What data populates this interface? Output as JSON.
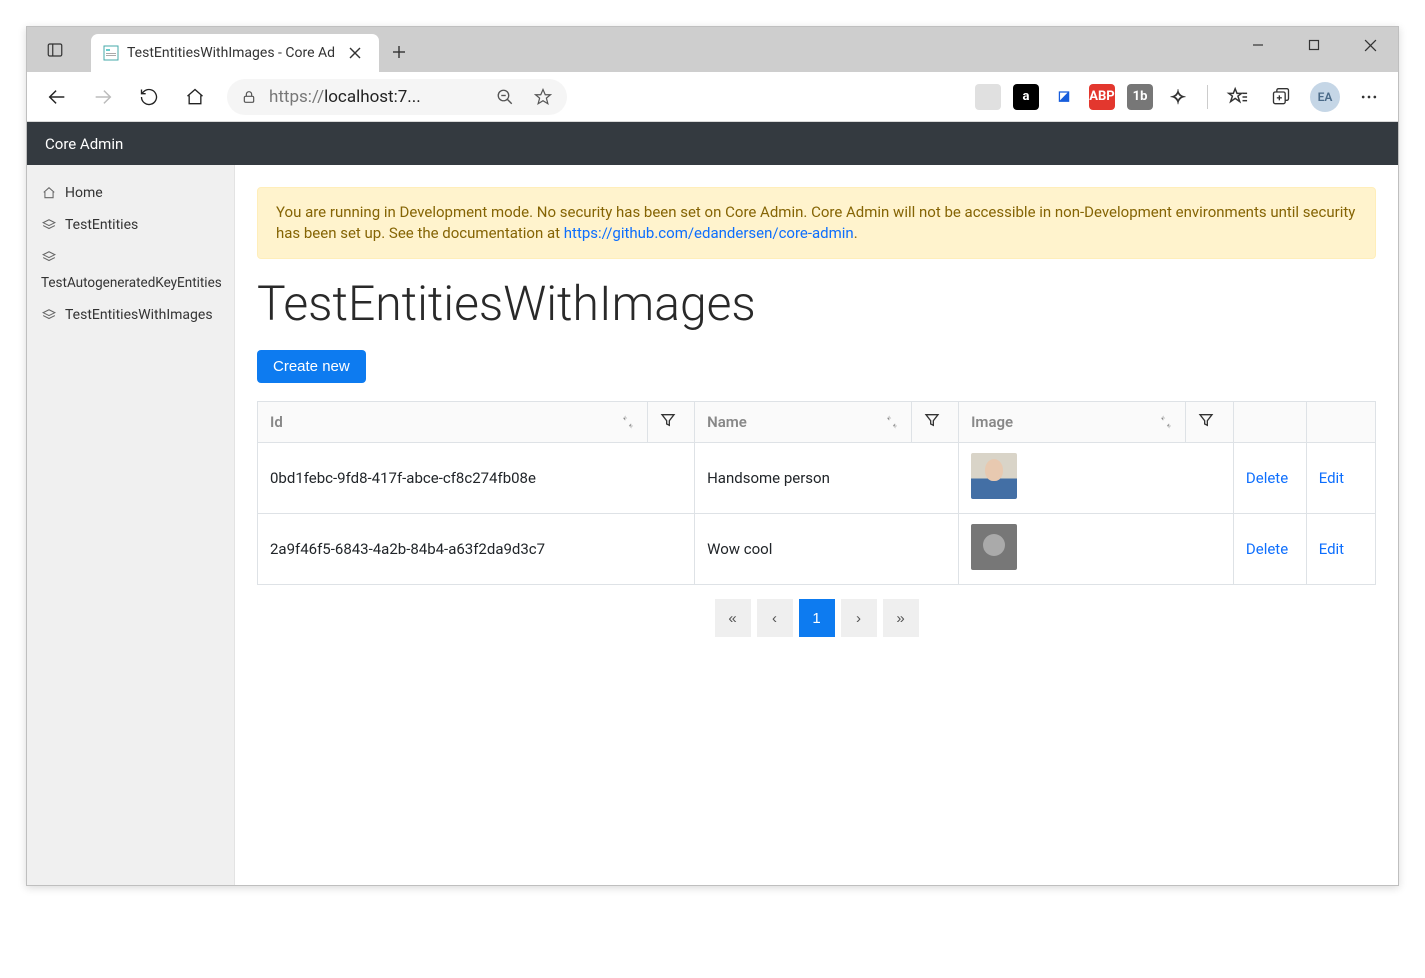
{
  "browser": {
    "tab_title": "TestEntitiesWithImages - Core Ad",
    "url_display": "localhost:7...",
    "url_prefix": "https://",
    "profile_initials": "EA",
    "extensions": [
      {
        "name": "ext-1",
        "bg": "#e0e0e0",
        "fg": "#888",
        "label": ""
      },
      {
        "name": "ext-privacy",
        "bg": "#000000",
        "fg": "#ffffff",
        "label": "a"
      },
      {
        "name": "ext-bitwarden",
        "bg": "#ffffff",
        "fg": "#175ddc",
        "label": "◪"
      },
      {
        "name": "ext-abp",
        "bg": "#e3372e",
        "fg": "#ffffff",
        "label": "ABP"
      },
      {
        "name": "ext-1b",
        "bg": "#777777",
        "fg": "#ffffff",
        "label": "1b"
      },
      {
        "name": "ext-puzzle",
        "bg": "transparent",
        "fg": "#333333",
        "label": "✧"
      }
    ]
  },
  "app": {
    "brand": "Core Admin",
    "sidebar": {
      "items": [
        {
          "label": "Home",
          "icon": "home"
        },
        {
          "label": "TestEntities",
          "icon": "stack"
        },
        {
          "label": "TestAutogeneratedKeyEntities",
          "icon": "stack",
          "wrap": true
        },
        {
          "label": "TestEntitiesWithImages",
          "icon": "stack"
        }
      ]
    },
    "alert": {
      "text_before_link": "You are running in Development mode. No security has been set on Core Admin. Core Admin will not be accessible in non-Development environments until security has been set up. See the documentation at ",
      "link_text": "https://github.com/edandersen/core-admin",
      "text_after_link": "."
    },
    "page_title": "TestEntitiesWithImages",
    "create_button": "Create new",
    "table": {
      "columns": [
        "Id",
        "Name",
        "Image"
      ],
      "rows": [
        {
          "id": "0bd1febc-9fd8-417f-abce-cf8c274fb08e",
          "name": "Handsome person",
          "thumb": "person1"
        },
        {
          "id": "2a9f46f5-6843-4a2b-84b4-a63f2da9d3c7",
          "name": "Wow cool",
          "thumb": "person2"
        }
      ],
      "actions": {
        "delete": "Delete",
        "edit": "Edit"
      }
    },
    "pagination": {
      "first": "«",
      "prev": "‹",
      "pages": [
        "1"
      ],
      "active": "1",
      "next": "›",
      "last": "»"
    }
  }
}
